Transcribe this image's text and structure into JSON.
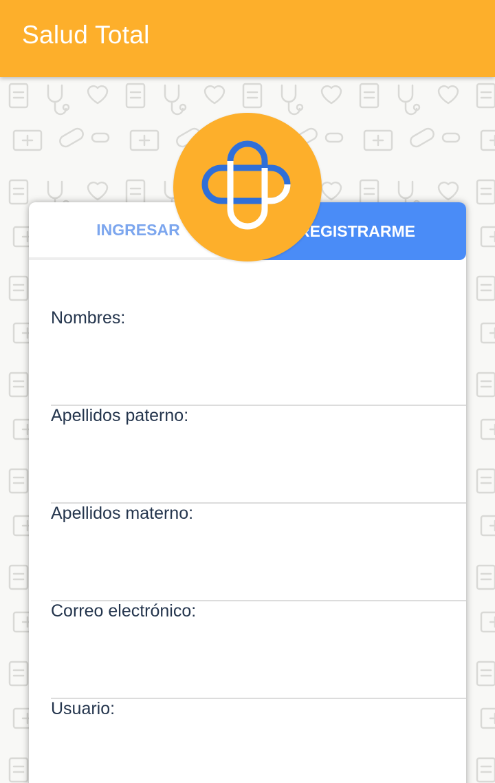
{
  "app": {
    "title": "Salud Total"
  },
  "tabs": {
    "login_label": "INGRESAR",
    "register_label": "REGISTRARME",
    "active": "register"
  },
  "form": {
    "fields": [
      {
        "label": "Nombres:",
        "value": ""
      },
      {
        "label": "Apellidos paterno:",
        "value": ""
      },
      {
        "label": "Apellidos materno:",
        "value": ""
      },
      {
        "label": "Correo electrónico:",
        "value": ""
      },
      {
        "label": "Usuario:",
        "value": ""
      }
    ]
  },
  "colors": {
    "appbar": "#FDAF2B",
    "tab_active": "#4A8CF7",
    "tab_inactive_text": "#7CA6EE",
    "label_text": "#24354d",
    "logo_blue": "#2F6FD8"
  },
  "icons": {
    "logo": "medical-cross-logo-icon",
    "background": "medical-doodle-pattern"
  }
}
